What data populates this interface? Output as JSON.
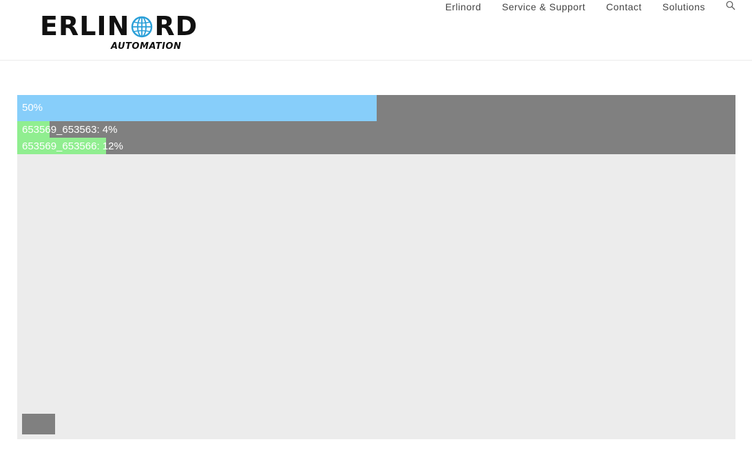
{
  "header": {
    "logo": {
      "text_left": "ERLIN",
      "text_right": "RD",
      "subtitle": "AUTOMATION",
      "globe_color": "#2a9fd8"
    },
    "nav": [
      {
        "label": "Erlinord"
      },
      {
        "label": "Service & Support"
      },
      {
        "label": "Contact"
      },
      {
        "label": "Solutions"
      }
    ],
    "search_icon": "search-icon"
  },
  "player": {
    "background": "#ececec",
    "track_color": "#808080",
    "main_progress": {
      "label": "50%",
      "value": 0.5,
      "color": "#87cefa"
    },
    "items": [
      {
        "label": "653569_653563: 4%",
        "value": 0.045,
        "color": "#90ee90"
      },
      {
        "label": "653569_653566: 12%",
        "value": 0.124,
        "color": "#90ee90"
      }
    ]
  }
}
